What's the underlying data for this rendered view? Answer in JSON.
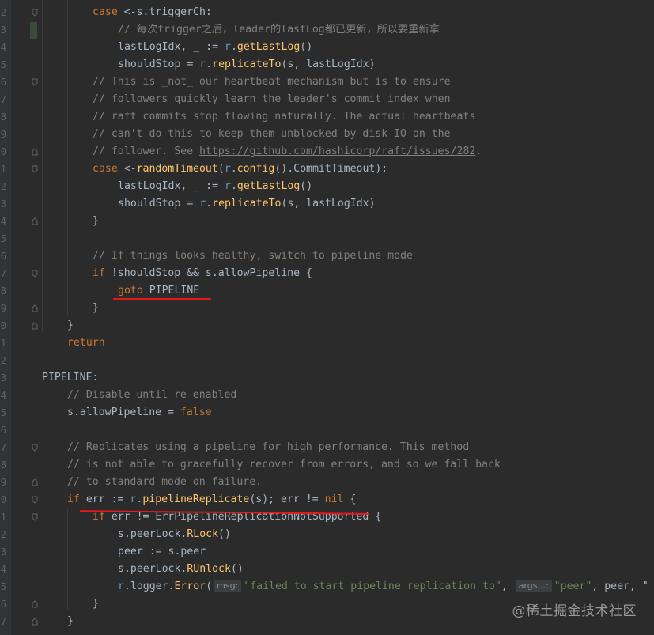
{
  "line_numbers": [
    "2",
    "3",
    "4",
    "5",
    "6",
    "7",
    "8",
    "9",
    "0",
    "1",
    "2",
    "3",
    "4",
    "5",
    "6",
    "7",
    "8",
    "9",
    "0",
    "1",
    "2",
    "3",
    "4",
    "5",
    "6",
    "7",
    "8",
    "9",
    "0",
    "1",
    "2",
    "3",
    "4",
    "5",
    "6",
    "7"
  ],
  "code": {
    "l0_case": "case",
    "l0_rest": " <-s.triggerCh:",
    "l1_comment": "// 每次trigger之后，leader的lastLog都已更新，所以要重新拿",
    "l2_a": "lastLogIdx, _ := ",
    "l2_r": "r",
    "l2_dot": ".",
    "l2_fn": "getLastLog",
    "l2_end": "()",
    "l3_a": "shouldStop = ",
    "l3_r": "r",
    "l3_dot": ".",
    "l3_fn": "replicateTo",
    "l3_end": "(s, lastLogIdx)",
    "l4": "// This is _not_ our heartbeat mechanism but is to ensure",
    "l5": "// followers quickly learn the leader's commit index when",
    "l6": "// raft commits stop flowing naturally. The actual heartbeats",
    "l7": "// can't do this to keep them unblocked by disk IO on the",
    "l8_a": "// follower. See ",
    "l8_link": "https://github.com/hashicorp/raft/issues/282",
    "l8_end": ".",
    "l9_case": "case",
    "l9_a": " <-",
    "l9_fn": "randomTimeout",
    "l9_b": "(",
    "l9_r": "r",
    "l9_c": ".",
    "l9_fn2": "config",
    "l9_d": "().CommitTimeout):",
    "l10_a": "lastLogIdx, _ := ",
    "l10_r": "r",
    "l10_dot": ".",
    "l10_fn": "getLastLog",
    "l10_end": "()",
    "l11_a": "shouldStop = ",
    "l11_r": "r",
    "l11_dot": ".",
    "l11_fn": "replicateTo",
    "l11_end": "(s, lastLogIdx)",
    "l12": "}",
    "l14": "// If things looks healthy, switch to pipeline mode",
    "l15_if": "if",
    "l15_rest": " !shouldStop && s.allowPipeline {",
    "l16_goto": "goto",
    "l16_rest": " PIPELINE",
    "l17": "}",
    "l18": "}",
    "l19": "return",
    "l21": "PIPELINE:",
    "l22": "// Disable until re-enabled",
    "l23_a": "s.allowPipeline = ",
    "l23_kw": "false",
    "l25": "// Replicates using a pipeline for high performance. This method",
    "l26": "// is not able to gracefully recover from errors, and so we fall back",
    "l27": "// to standard mode on failure.",
    "l28_if": "if",
    "l28_a": " err := ",
    "l28_r": "r",
    "l28_dot": ".",
    "l28_fn": "pipelineReplicate",
    "l28_b": "(s); err != ",
    "l28_nil": "nil",
    "l28_c": " {",
    "l29_if": "if",
    "l29_rest": " err != ErrPipelineReplicationNotSupported {",
    "l30_a": "s.peerLock.",
    "l30_fn": "RLock",
    "l30_end": "()",
    "l31": "peer := s.peer",
    "l32_a": "s.peerLock.",
    "l32_fn": "RUnlock",
    "l32_end": "()",
    "l33_r": "r",
    "l33_a": ".logger.",
    "l33_fn": "Error",
    "l33_b": "(",
    "l33_hint1": "msg:",
    "l33_str": "\"failed to start pipeline replication to\"",
    "l33_c": ", ",
    "l33_hint2": "args...:",
    "l33_str2": "\"peer\"",
    "l33_d": ", peer, \"",
    "l34": "}",
    "l35": "}"
  },
  "watermark": "@稀土掘金技术社区",
  "colors": {
    "background": "#2b2b2b",
    "keyword": "#cc7832",
    "function": "#ffc66d",
    "receiver": "#6897bb",
    "comment": "#808080",
    "string": "#6a8759",
    "underline_annotation": "#e8181a"
  }
}
